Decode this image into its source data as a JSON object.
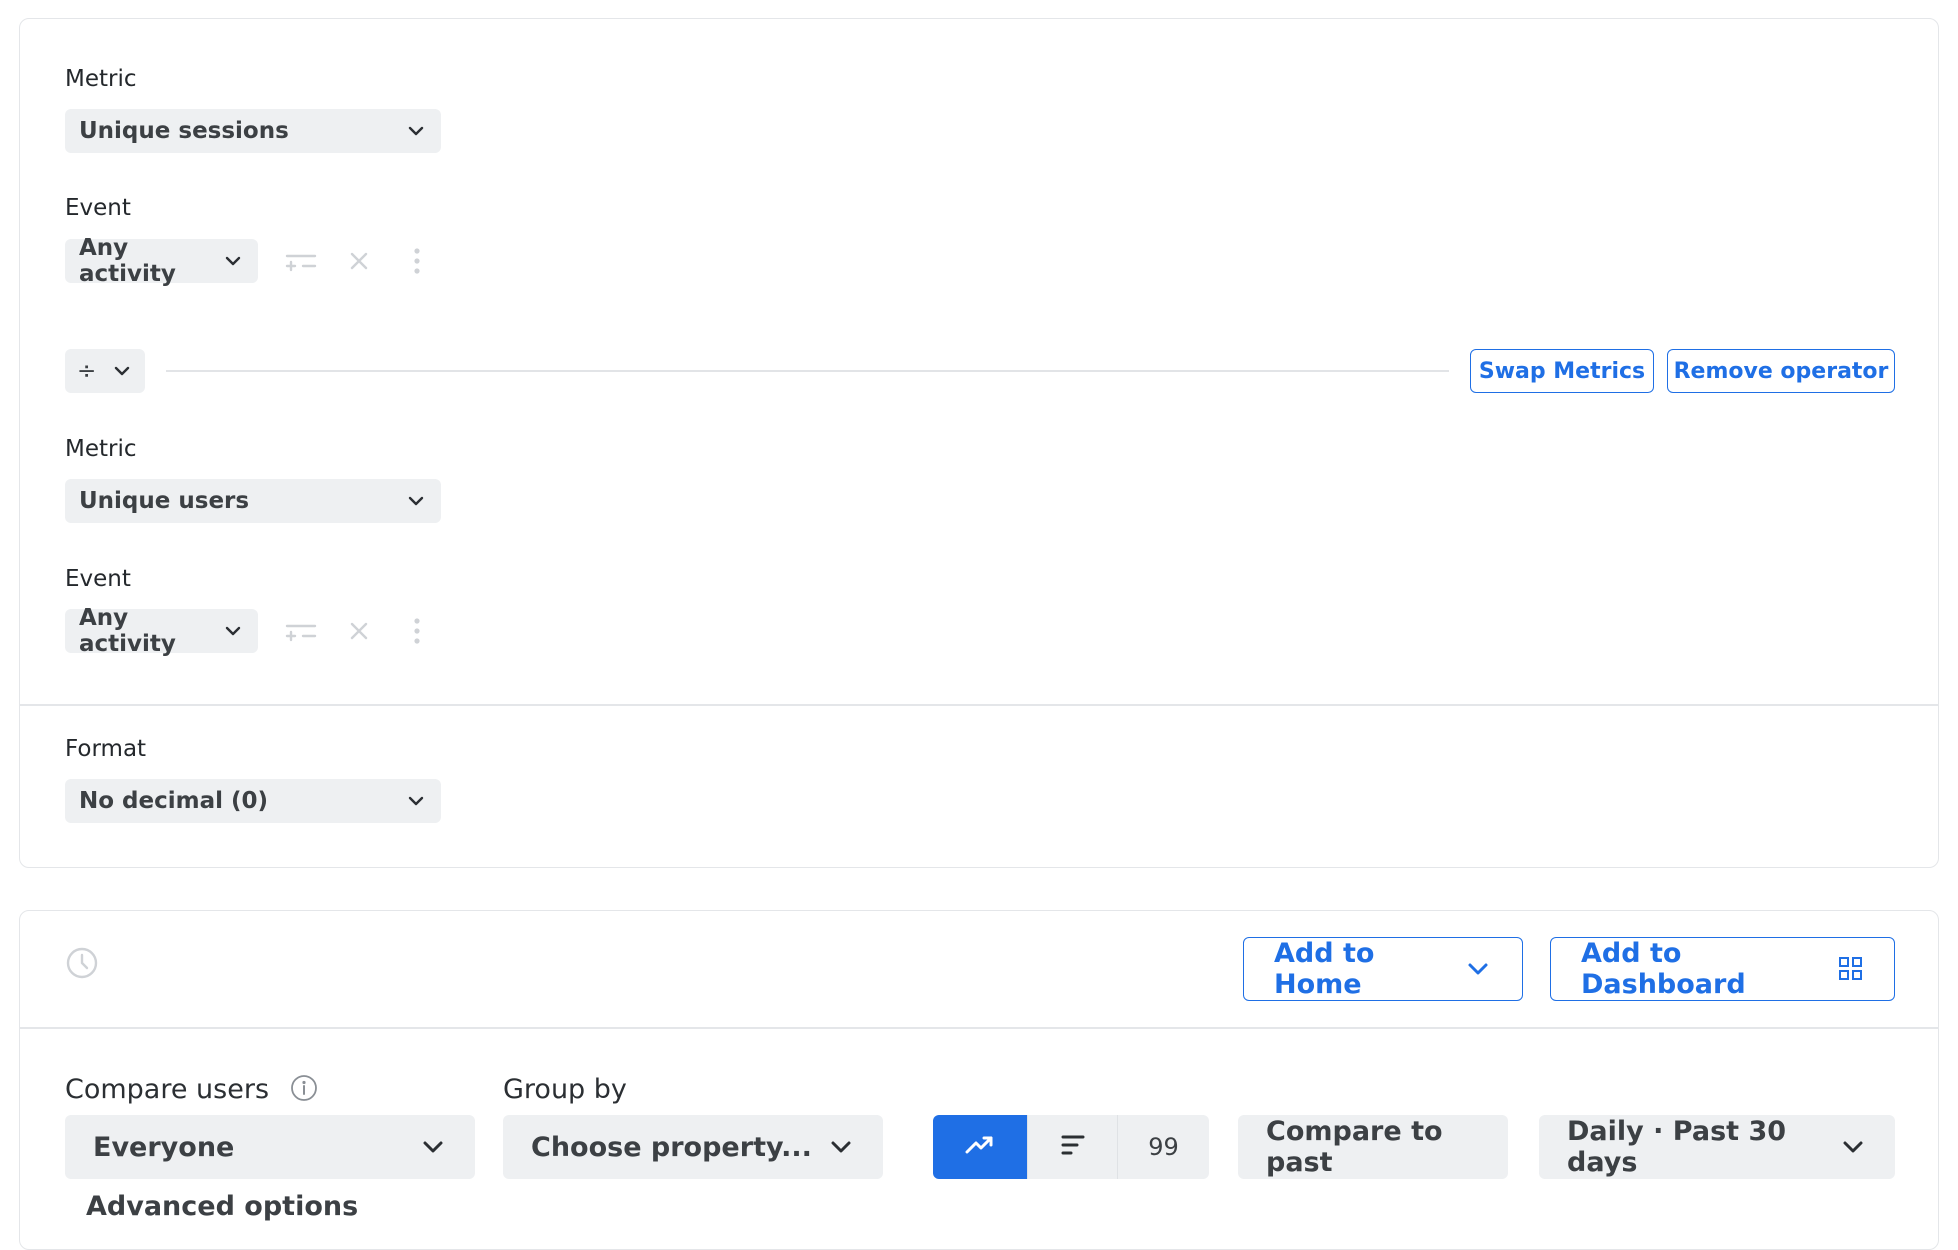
{
  "formula": {
    "metric_a": {
      "metric_label": "Metric",
      "metric_value": "Unique sessions",
      "event_label": "Event",
      "event_value": "Any activity"
    },
    "operator": {
      "symbol": "÷",
      "swap_label": "Swap Metrics",
      "remove_label": "Remove operator"
    },
    "metric_b": {
      "metric_label": "Metric",
      "metric_value": "Unique users",
      "event_label": "Event",
      "event_value": "Any activity"
    },
    "format": {
      "label": "Format",
      "value": "No decimal (0)"
    }
  },
  "toolbar": {
    "history_icon": "clock-icon",
    "add_home_label": "Add to Home",
    "add_dashboard_label": "Add to Dashboard"
  },
  "controls": {
    "compare_users_label": "Compare users",
    "compare_users_value": "Everyone",
    "group_by_label": "Group by",
    "group_by_placeholder": "Choose property...",
    "view_modes": [
      "line-chart-icon",
      "bar-list-icon",
      "99"
    ],
    "view_mode_active": "line-chart-icon",
    "compare_past_label": "Compare to past",
    "date_range_value": "Daily · Past 30 days",
    "advanced_label": "Advanced options"
  },
  "colors": {
    "accent": "#1f6fe5",
    "control_bg": "#eef0f2",
    "border": "#e4e6e9"
  }
}
